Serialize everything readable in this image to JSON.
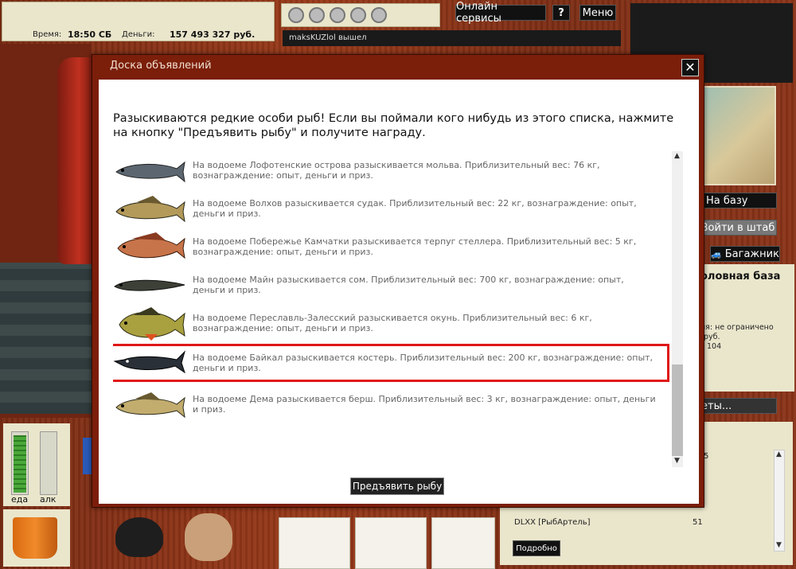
{
  "hud": {
    "time_label": "Время:",
    "time_value": "18:50 СБ",
    "money_label": "Деньги:",
    "money_value": "157 493 327 руб."
  },
  "topbar": {
    "online_services": "Онлайн сервисы",
    "help": "?",
    "menu": "Меню",
    "chat_line": "maksKUZlol вышел"
  },
  "right_panel": {
    "to_base": "На базу",
    "enter_hq": "Войти в штаб",
    "trunk": "Багажник",
    "base_name": "оловная база",
    "info_line1": "ия: не ограничено",
    "info_line2": "руб.",
    "info_line3": "104",
    "secrets": "еты...",
    "list_number": "5",
    "clan_entry": "DLXX [РыбАртель]",
    "clan_count": "51",
    "details_button": "Подробно"
  },
  "meters": {
    "food": "еда",
    "alc": "алк",
    "food_level": 0.95,
    "alc_level": 0.0
  },
  "dialog": {
    "title": "Доска объявлений",
    "close": "✕",
    "intro": "Разыскиваются редкие особи рыб! Если вы поймали кого нибудь из этого списка, нажмите на кнопку \"Предъявить рыбу\" и получите награду.",
    "present_button": "Предъявить рыбу",
    "items": [
      {
        "fish": "ling-icon",
        "text": "На водоеме Лофотенские острова разыскивается мольва. Приблизительный вес: 76 кг, вознаграждение: опыт, деньги и приз."
      },
      {
        "fish": "zander-icon",
        "text": "На водоеме Волхов разыскивается судак. Приблизительный вес: 22 кг, вознаграждение: опыт, деньги и приз."
      },
      {
        "fish": "greenling-icon",
        "text": "На водоеме Побережье Камчатки разыскивается терпуг стеллера. Приблизительный вес: 5 кг, вознаграждение: опыт, деньги и приз."
      },
      {
        "fish": "catfish-icon",
        "text": "На водоеме Майн разыскивается сом. Приблизительный вес: 700 кг, вознаграждение: опыт, деньги и приз."
      },
      {
        "fish": "perch-icon",
        "text": "На водоеме Переславль-Залесский разыскивается окунь. Приблизительный вес: 6 кг, вознаграждение: опыт, деньги и приз."
      },
      {
        "fish": "sterlet-icon",
        "text": "На водоеме Байкал разыскивается костерь. Приблизительный вес: 200 кг, вознаграждение: опыт, деньги и приз."
      },
      {
        "fish": "volga-zander-icon",
        "text": "На водоеме Дема разыскивается берш. Приблизительный вес: 3 кг, вознаграждение: опыт, деньги и приз."
      }
    ]
  }
}
